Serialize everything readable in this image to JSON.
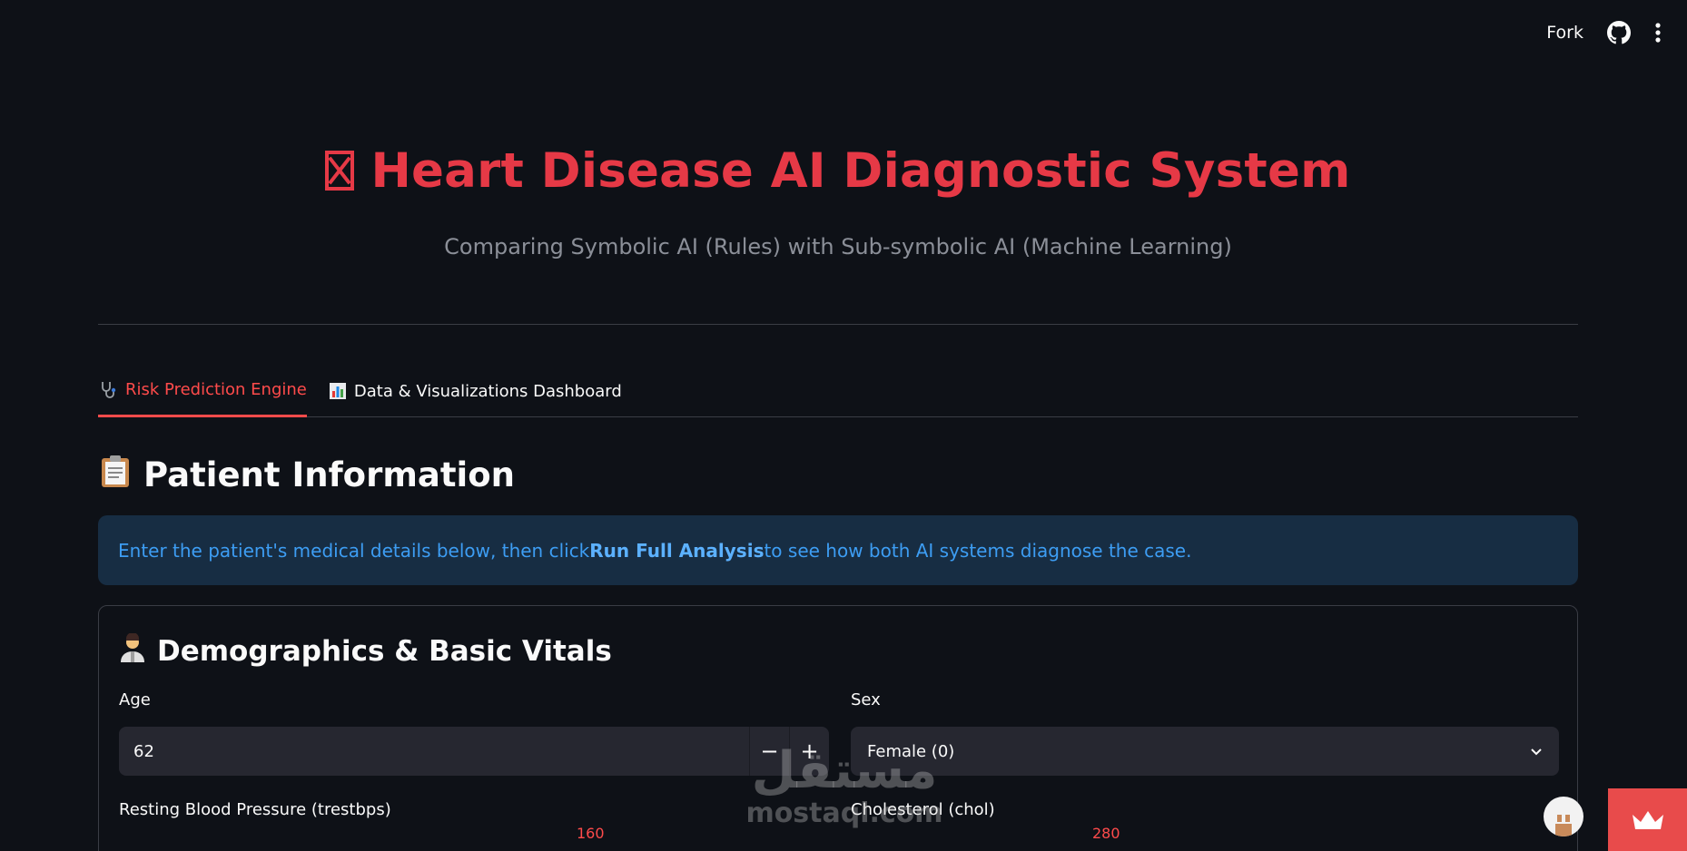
{
  "header": {
    "fork_label": "Fork",
    "github_icon": "github-icon",
    "menu_icon": "kebab-menu-icon"
  },
  "hero": {
    "title": "Heart Disease AI Diagnostic System",
    "subtitle": "Comparing Symbolic AI (Rules) with Sub-symbolic AI (Machine Learning)",
    "title_color": "#e63946"
  },
  "tabs": [
    {
      "label": "Risk Prediction Engine",
      "icon": "stethoscope-icon",
      "active": true
    },
    {
      "label": "Data & Visualizations Dashboard",
      "icon": "bar-chart-icon",
      "active": false
    }
  ],
  "section": {
    "title": "Patient Information",
    "icon": "clipboard-icon"
  },
  "info": {
    "prefix": "Enter the patient's medical details below, then click ",
    "bold": "Run Full Analysis",
    "suffix": " to see how both AI systems diagnose the case."
  },
  "card": {
    "title": "Demographics & Basic Vitals",
    "icon": "doctor-icon",
    "age": {
      "label": "Age",
      "value": "62",
      "minus": "−",
      "plus": "+"
    },
    "sex": {
      "label": "Sex",
      "value": "Female (0)"
    },
    "trestbps": {
      "label": "Resting Blood Pressure (trestbps)",
      "value": "160"
    },
    "chol": {
      "label": "Cholesterol (chol)",
      "value": "280"
    }
  },
  "watermark": {
    "arabic": "مستقل",
    "latin": "mostaql.com"
  },
  "accent": "#ff4b4b"
}
